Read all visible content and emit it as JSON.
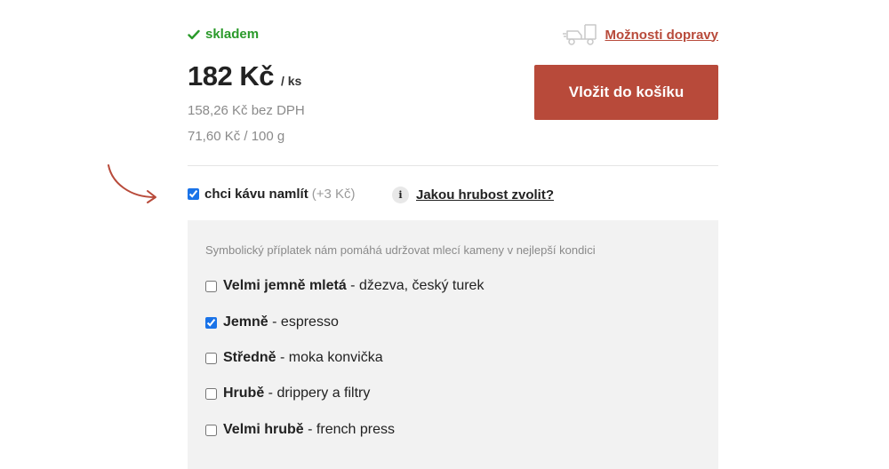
{
  "stock": {
    "icon": "check-icon",
    "label": "skladem"
  },
  "shipping": {
    "icon": "truck-icon",
    "label": "Možnosti dopravy"
  },
  "price": {
    "amount": "182 Kč",
    "unit": "/ ks",
    "without_vat": "158,26 Kč bez DPH",
    "per_weight": "71,60 Kč / 100 g"
  },
  "cart": {
    "button_label": "Vložit do košíku"
  },
  "grind": {
    "checked": true,
    "label": "chci kávu namlít",
    "extra": "(+3 Kč)",
    "help_icon": "info-icon",
    "help_link": "Jakou hrubost zvolit?"
  },
  "grind_options": {
    "note": "Symbolický příplatek nám pomáhá udržovat mlecí kameny v nejlepší kondici",
    "items": [
      {
        "bold": "Velmi jemně mletá",
        "rest": " - džezva, český turek",
        "checked": false
      },
      {
        "bold": "Jemně",
        "rest": " - espresso",
        "checked": true
      },
      {
        "bold": "Středně",
        "rest": " - moka konvička",
        "checked": false
      },
      {
        "bold": "Hrubě",
        "rest": " - drippery a filtry",
        "checked": false
      },
      {
        "bold": "Velmi hrubě",
        "rest": " - french press",
        "checked": false
      }
    ]
  },
  "colors": {
    "accent": "#b84a3a",
    "stock_green": "#2a9a2a",
    "muted_text": "#8a8a8a",
    "panel_bg": "#f2f2f2",
    "checkbox_blue": "#1a73e8"
  }
}
